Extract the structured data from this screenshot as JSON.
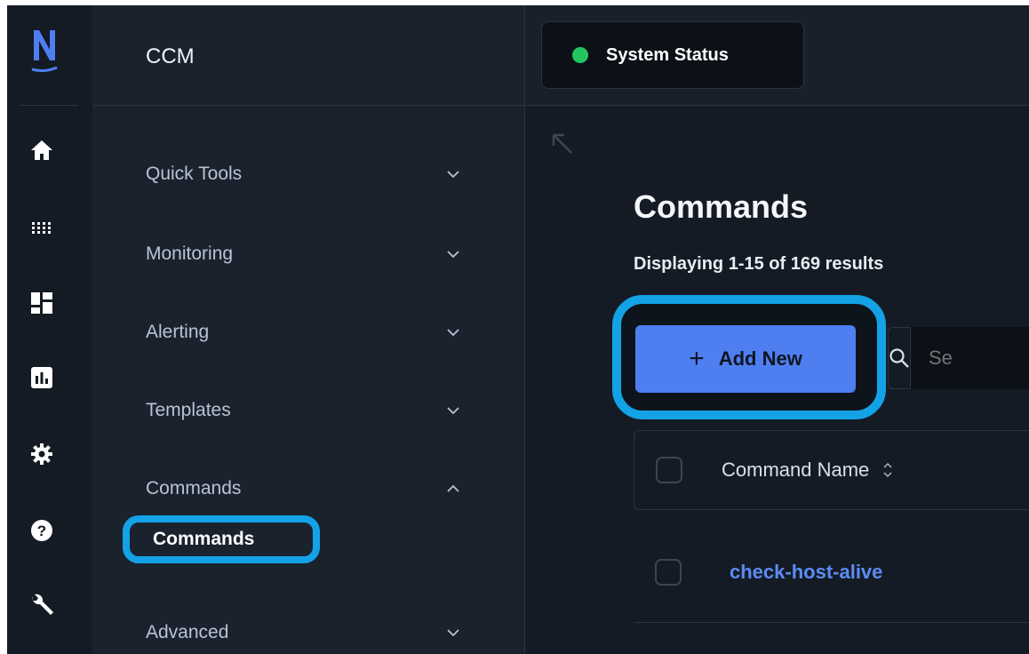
{
  "app": {
    "title": "CCM"
  },
  "rail": {
    "items": [
      {
        "icon": "home-icon"
      },
      {
        "icon": "grid-icon"
      },
      {
        "icon": "dashboard-icon"
      },
      {
        "icon": "reports-icon"
      },
      {
        "icon": "gear-icon"
      },
      {
        "icon": "help-icon"
      },
      {
        "icon": "wrench-icon"
      }
    ]
  },
  "sidebar": {
    "items": [
      {
        "label": "Quick Tools",
        "expanded": false
      },
      {
        "label": "Monitoring",
        "expanded": false
      },
      {
        "label": "Alerting",
        "expanded": false
      },
      {
        "label": "Templates",
        "expanded": false
      },
      {
        "label": "Commands",
        "expanded": true
      },
      {
        "label": "Advanced",
        "expanded": false
      }
    ],
    "sub_item": "Commands"
  },
  "header": {
    "status_label": "System Status",
    "status_color": "#22c55e"
  },
  "main": {
    "title": "Commands",
    "results": "Displaying 1-15 of 169 results",
    "add_label": "Add New",
    "search_placeholder": "Se",
    "table": {
      "column": "Command Name",
      "rows": [
        {
          "name": "check-host-alive"
        }
      ]
    }
  },
  "colors": {
    "accent": "#4f7ef1",
    "highlight": "#14a2e6",
    "link": "#5c8cf3"
  }
}
